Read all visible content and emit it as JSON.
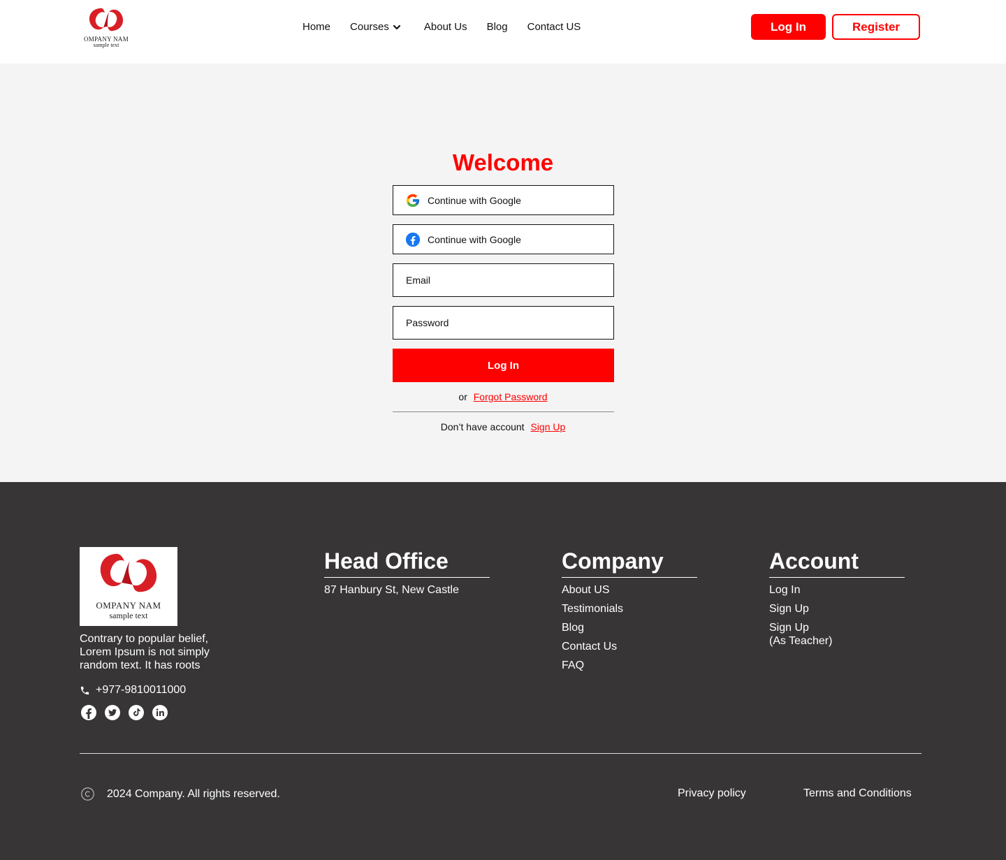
{
  "header": {
    "logo": {
      "line1": "OMPANY NAM",
      "line2": "sample text"
    },
    "nav": {
      "home": "Home",
      "courses": "Courses",
      "about": "About Us",
      "blog": "Blog",
      "contact": "Contact US"
    },
    "login_label": "Log In",
    "register_label": "Register"
  },
  "colors": {
    "accent": "#ff0000",
    "footer_bg": "#373536",
    "main_bg": "#f4f4f4"
  },
  "login": {
    "title": "Welcome",
    "google_label": "Continue with Google",
    "facebook_label": "Continue with Google",
    "email_placeholder": "Email",
    "password_placeholder": "Password",
    "submit_label": "Log In",
    "or_text": "or",
    "forgot_label": "Forgot Password",
    "no_account_text": "Don’t have account",
    "signup_label": "Sign Up"
  },
  "footer": {
    "logo": {
      "line1": "OMPANY NAM",
      "line2": "sample text"
    },
    "description": "Contrary to popular belief, Lorem Ipsum is not simply random text. It has roots",
    "phone": "+977-9810011000",
    "socials": [
      "facebook-icon",
      "twitter-icon",
      "tiktok-icon",
      "linkedin-icon"
    ],
    "head_office": {
      "title": "Head Office",
      "address": "87 Hanbury St, New Castle"
    },
    "company": {
      "title": "Company",
      "links": [
        "About US",
        "Testimonials",
        "Blog",
        "Contact Us",
        "FAQ"
      ]
    },
    "account": {
      "title": "Account",
      "links": [
        "Log In",
        "Sign Up",
        "Sign Up",
        "(As Teacher)"
      ]
    },
    "copyright": "2024 Company. All rights reserved.",
    "privacy": "Privacy policy",
    "terms": "Terms and Conditions"
  }
}
